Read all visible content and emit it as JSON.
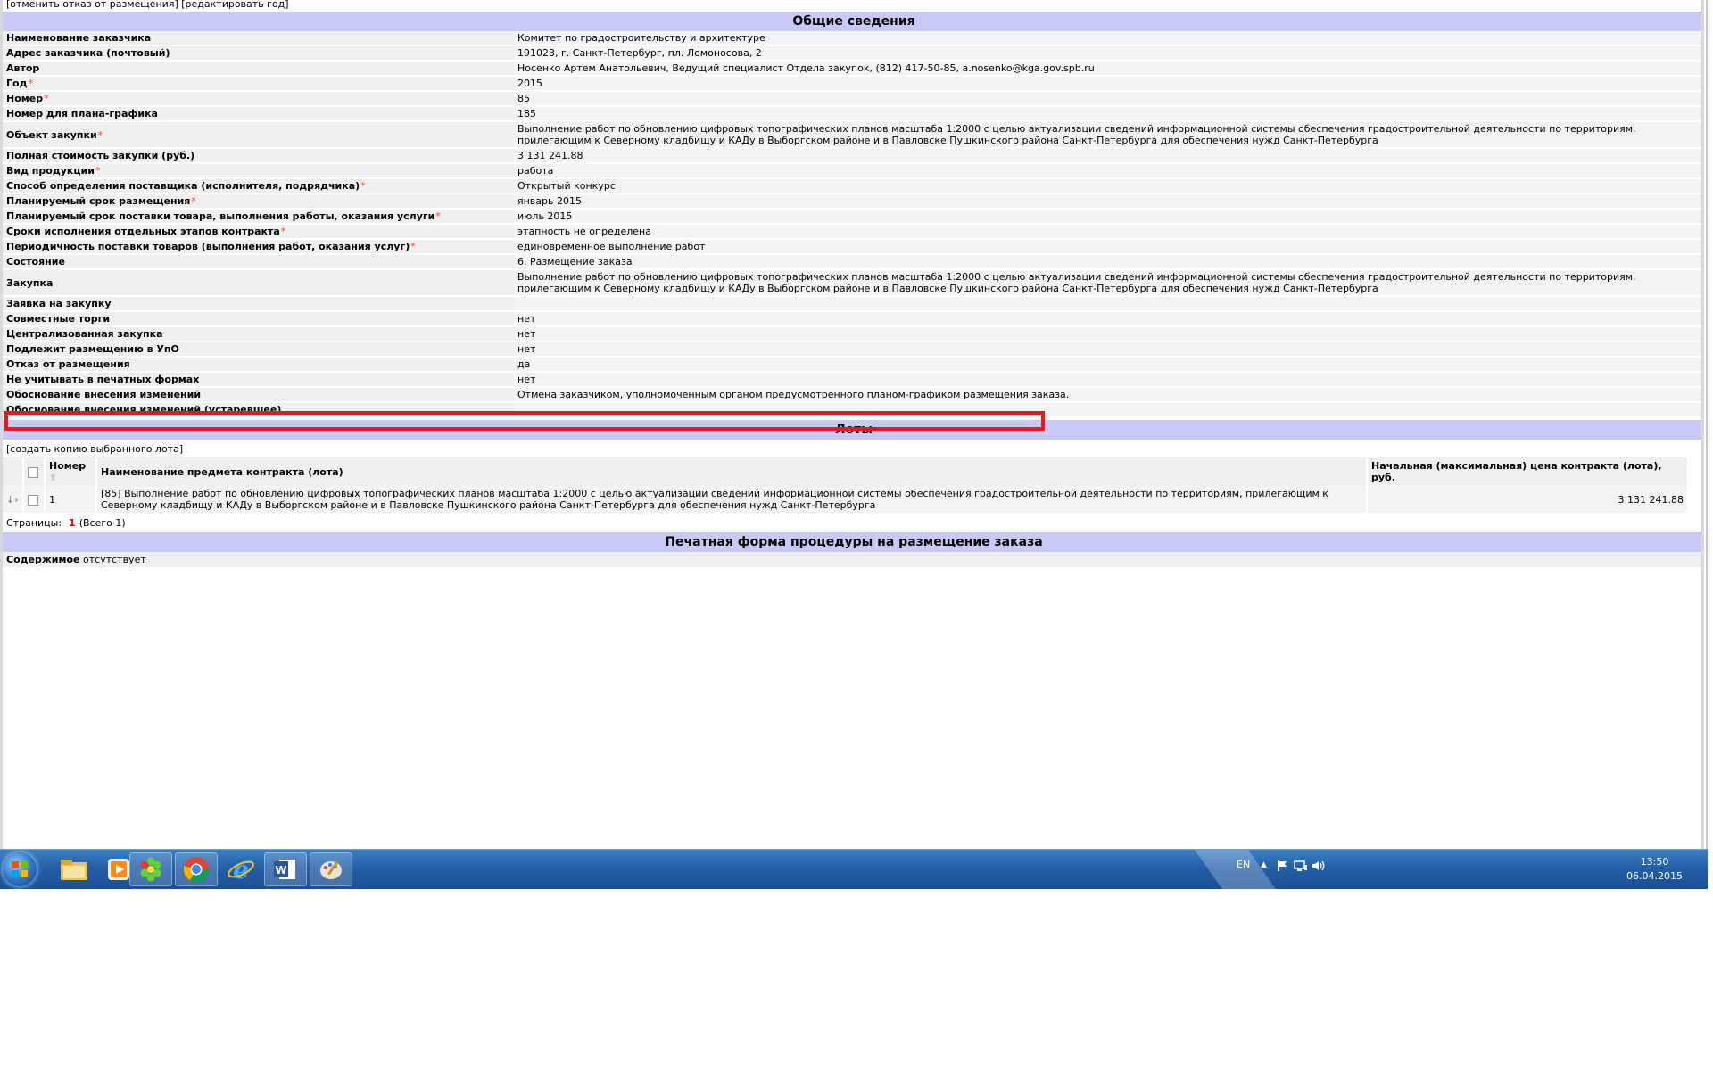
{
  "links": {
    "cancel_refusal": "[отменить отказ от размещения]",
    "edit_year": "[редактировать год]",
    "copy_lot": "[создать копию выбранного лота]"
  },
  "sections": {
    "general": "Общие сведения",
    "lots": "Лоты",
    "print_form": "Печатная форма процедуры на размещение заказа"
  },
  "properties": [
    {
      "label": "Наименование заказчика",
      "value": "Комитет по градостроительству и архитектуре",
      "required": false
    },
    {
      "label": "Адрес заказчика (почтовый)",
      "value": "191023, г. Санкт-Петербург, пл. Ломоносова, 2",
      "required": false
    },
    {
      "label": "Автор",
      "value": "Носенко Артем Анатольевич, Ведущий специалист Отдела закупок, (812) 417-50-85, a.nosenko@kga.gov.spb.ru",
      "required": false
    },
    {
      "label": "Год",
      "value": "2015",
      "required": true
    },
    {
      "label": "Номер",
      "value": "85",
      "required": true
    },
    {
      "label": "Номер для плана-графика",
      "value": "185",
      "required": false
    },
    {
      "label": "Объект закупки",
      "value": "Выполнение работ по обновлению цифровых топографических планов масштаба 1:2000 с целью актуализации сведений информационной системы обеспечения градостроительной деятельности по территориям, прилегающим к Северному кладбищу и КАДу в Выборгском районе и в Павловске Пушкинского района Санкт-Петербурга для обеспечения нужд Санкт-Петербурга",
      "required": true
    },
    {
      "label": "Полная стоимость закупки (руб.)",
      "value": "3 131 241.88",
      "required": false
    },
    {
      "label": "Вид продукции",
      "value": "работа",
      "required": true
    },
    {
      "label": "Способ определения поставщика (исполнителя, подрядчика)",
      "value": "Открытый конкурс",
      "required": true
    },
    {
      "label": "Планируемый срок размещения",
      "value": "январь 2015",
      "required": true
    },
    {
      "label": "Планируемый срок поставки товара, выполнения работы, оказания услуги",
      "value": "июль 2015",
      "required": true
    },
    {
      "label": "Сроки исполнения отдельных этапов контракта",
      "value": "этапность не определена",
      "required": true
    },
    {
      "label": "Периодичность поставки товаров (выполнения работ, оказания услуг)",
      "value": "единовременное выполнение работ",
      "required": true
    },
    {
      "label": "Состояние",
      "value": "6. Размещение заказа",
      "required": false
    },
    {
      "label": "Закупка",
      "value": "Выполнение работ по обновлению цифровых топографических планов масштаба 1:2000 с целью актуализации сведений информационной системы обеспечения градостроительной деятельности по территориям, прилегающим к Северному кладбищу и КАДу в Выборгском районе и в Павловске Пушкинского района Санкт-Петербурга для обеспечения нужд Санкт-Петербурга",
      "required": false
    },
    {
      "label": "Заявка на закупку",
      "value": "",
      "required": false
    },
    {
      "label": "Совместные торги",
      "value": "нет",
      "required": false
    },
    {
      "label": "Централизованная закупка",
      "value": "нет",
      "required": false
    },
    {
      "label": "Подлежит размещению в УпО",
      "value": "нет",
      "required": false
    },
    {
      "label": "Отказ от размещения",
      "value": "да",
      "required": false
    },
    {
      "label": "Не учитывать в печатных формах",
      "value": "нет",
      "required": false
    },
    {
      "label": "Обоснование внесения изменений",
      "value": "Отмена заказчиком, уполномоченным органом предусмотренного планом-графиком размещения заказа.",
      "required": false
    },
    {
      "label": "Обоснование внесения изменений (устаревшее)",
      "value": "",
      "required": false
    }
  ],
  "lots": {
    "headers": {
      "number": "Номер",
      "subject": "Наименование предмета контракта (лота)",
      "price": "Начальная (максимальная) цена контракта (лота), руб."
    },
    "rows": [
      {
        "number": "1",
        "subject": "[85] Выполнение работ по обновлению цифровых топографических планов масштаба 1:2000 с целью актуализации сведений информационной системы обеспечения градостроительной деятельности по территориям, прилегающим к Северному кладбищу и КАДу в Выборгском районе и в Павловске Пушкинского района Санкт-Петербурга для обеспечения нужд Санкт-Петербурга",
        "price": "3 131 241.88"
      }
    ],
    "pager_label": "Страницы:",
    "pager_current": "1",
    "pager_total": "(Всего 1)"
  },
  "print_form": {
    "label": "Содержимое",
    "value": "отсутствует"
  },
  "taskbar": {
    "icons": [
      "windows-start-icon",
      "explorer-folder-icon",
      "media-player-icon",
      "icq-flower-icon",
      "chrome-icon",
      "internet-explorer-icon",
      "word-icon",
      "paint-icon"
    ],
    "lang": "EN",
    "time": "13:50",
    "date": "06.04.2015"
  },
  "colors": {
    "section_header_bg": "#c9c9f7",
    "highlight_border": "#e3191f",
    "required_mark": "#ff3b3b",
    "taskbar_blue": "#245fa8"
  }
}
